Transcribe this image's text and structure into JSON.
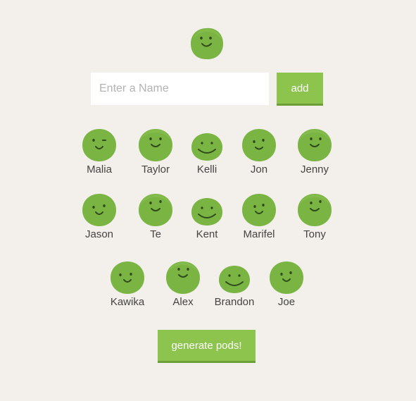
{
  "form": {
    "name_placeholder": "Enter a Name",
    "name_value": "",
    "add_label": "add"
  },
  "peas": [
    {
      "name": "Malia"
    },
    {
      "name": "Taylor"
    },
    {
      "name": "Kelli"
    },
    {
      "name": "Jon"
    },
    {
      "name": "Jenny"
    },
    {
      "name": "Jason"
    },
    {
      "name": "Te"
    },
    {
      "name": "Kent"
    },
    {
      "name": "Marifel"
    },
    {
      "name": "Tony"
    },
    {
      "name": "Kawika"
    },
    {
      "name": "Alex"
    },
    {
      "name": "Brandon"
    },
    {
      "name": "Joe"
    }
  ],
  "actions": {
    "generate_label": "generate pods!"
  },
  "colors": {
    "background": "#f3f0eb",
    "pea_green": "#7ab443",
    "button_green": "#8dc44d"
  }
}
